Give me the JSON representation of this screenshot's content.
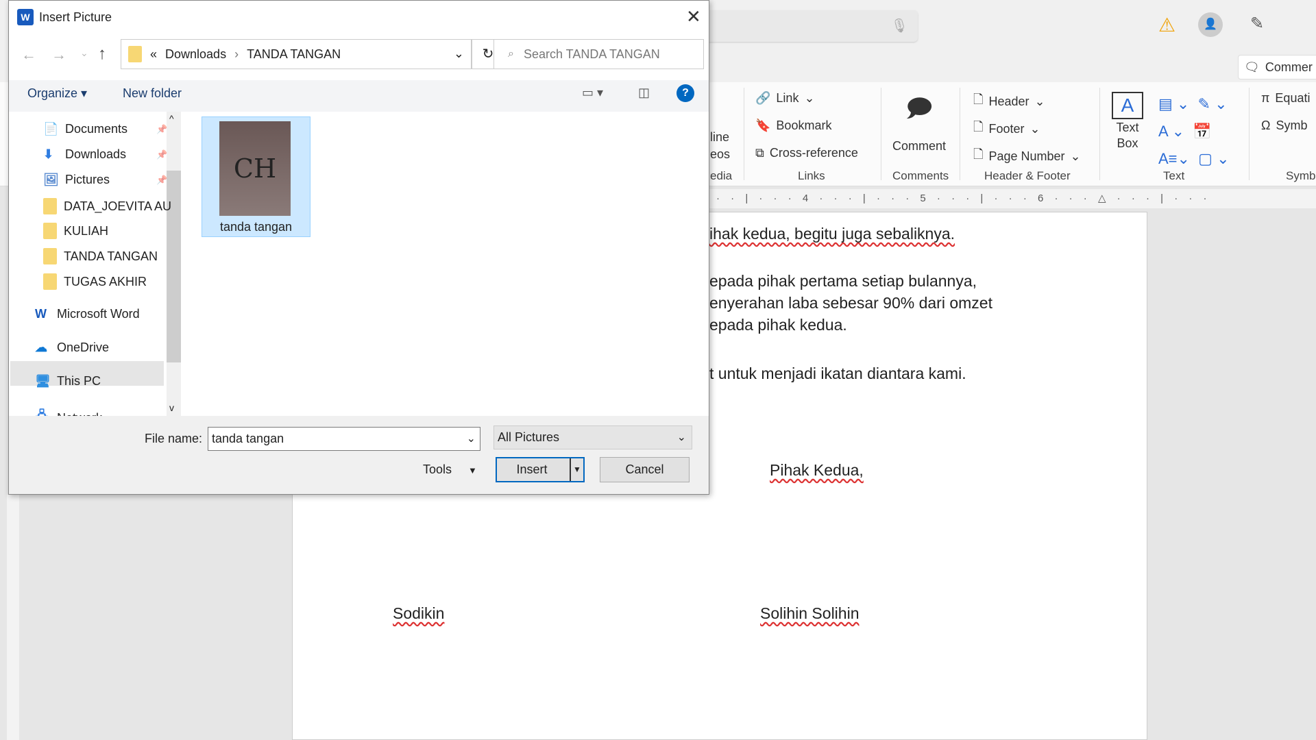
{
  "word": {
    "ribbon": {
      "media_partial": [
        "line",
        "eos"
      ],
      "media_label": "edia",
      "link": "Link",
      "bookmark": "Bookmark",
      "cross_reference": "Cross-reference",
      "links_label": "Links",
      "comment": "Comment",
      "comments_label": "Comments",
      "header": "Header",
      "footer": "Footer",
      "page_number": "Page Number",
      "header_footer_label": "Header & Footer",
      "text_box_1": "Text",
      "text_box_2": "Box",
      "text_label": "Text",
      "equation": "Equati",
      "symbol": "Symb",
      "symbols_label": "Symb",
      "comments_button": "Commer"
    },
    "ruler": "· · | · · · 4 · · · | · · · 5 · · · | · · · 6 · · · △ · · · | · · ·",
    "document": {
      "line1": "ihak kedua, begitu juga sebaliknya.",
      "line2": "epada pihak pertama setiap bulannya,",
      "line3": "enyerahan laba sebesar 90% dari omzet",
      "line4": "epada pihak kedua.",
      "line5": "t untuk menjadi ikatan diantara kami.",
      "party2_title": "Pihak Kedua,",
      "party1_name": "Sodikin",
      "party2_name": "Solihin Solihin"
    }
  },
  "dialog": {
    "title": "Insert Picture",
    "breadcrumb": [
      "«",
      "Downloads",
      "›",
      "TANDA TANGAN"
    ],
    "search_placeholder": "Search TANDA TANGAN",
    "organize": "Organize ▾",
    "new_folder": "New folder",
    "nav_items": [
      {
        "label": "Documents",
        "icon": "documents-icon",
        "pinned": true
      },
      {
        "label": "Downloads",
        "icon": "download-icon",
        "pinned": true
      },
      {
        "label": "Pictures",
        "icon": "pictures-icon",
        "pinned": true
      },
      {
        "label": "DATA_JOEVITA AU",
        "icon": "folder-icon"
      },
      {
        "label": "KULIAH",
        "icon": "folder-icon"
      },
      {
        "label": "TANDA TANGAN",
        "icon": "folder-icon"
      },
      {
        "label": "TUGAS AKHIR",
        "icon": "folder-icon"
      },
      {
        "label": "Microsoft Word",
        "icon": "word-icon"
      },
      {
        "label": "OneDrive",
        "icon": "onedrive-icon"
      },
      {
        "label": "This PC",
        "icon": "pc-icon",
        "selected": true
      },
      {
        "label": "Network",
        "icon": "network-icon"
      }
    ],
    "file": {
      "name": "tanda tangan",
      "selected": true
    },
    "file_name_label": "File name:",
    "file_name_value": "tanda tangan",
    "file_type": "All Pictures",
    "tools": "Tools",
    "insert": "Insert",
    "cancel": "Cancel"
  },
  "colors": {
    "accent": "#0067c0",
    "selection": "#cce8ff",
    "warning": "#f0a30a"
  }
}
